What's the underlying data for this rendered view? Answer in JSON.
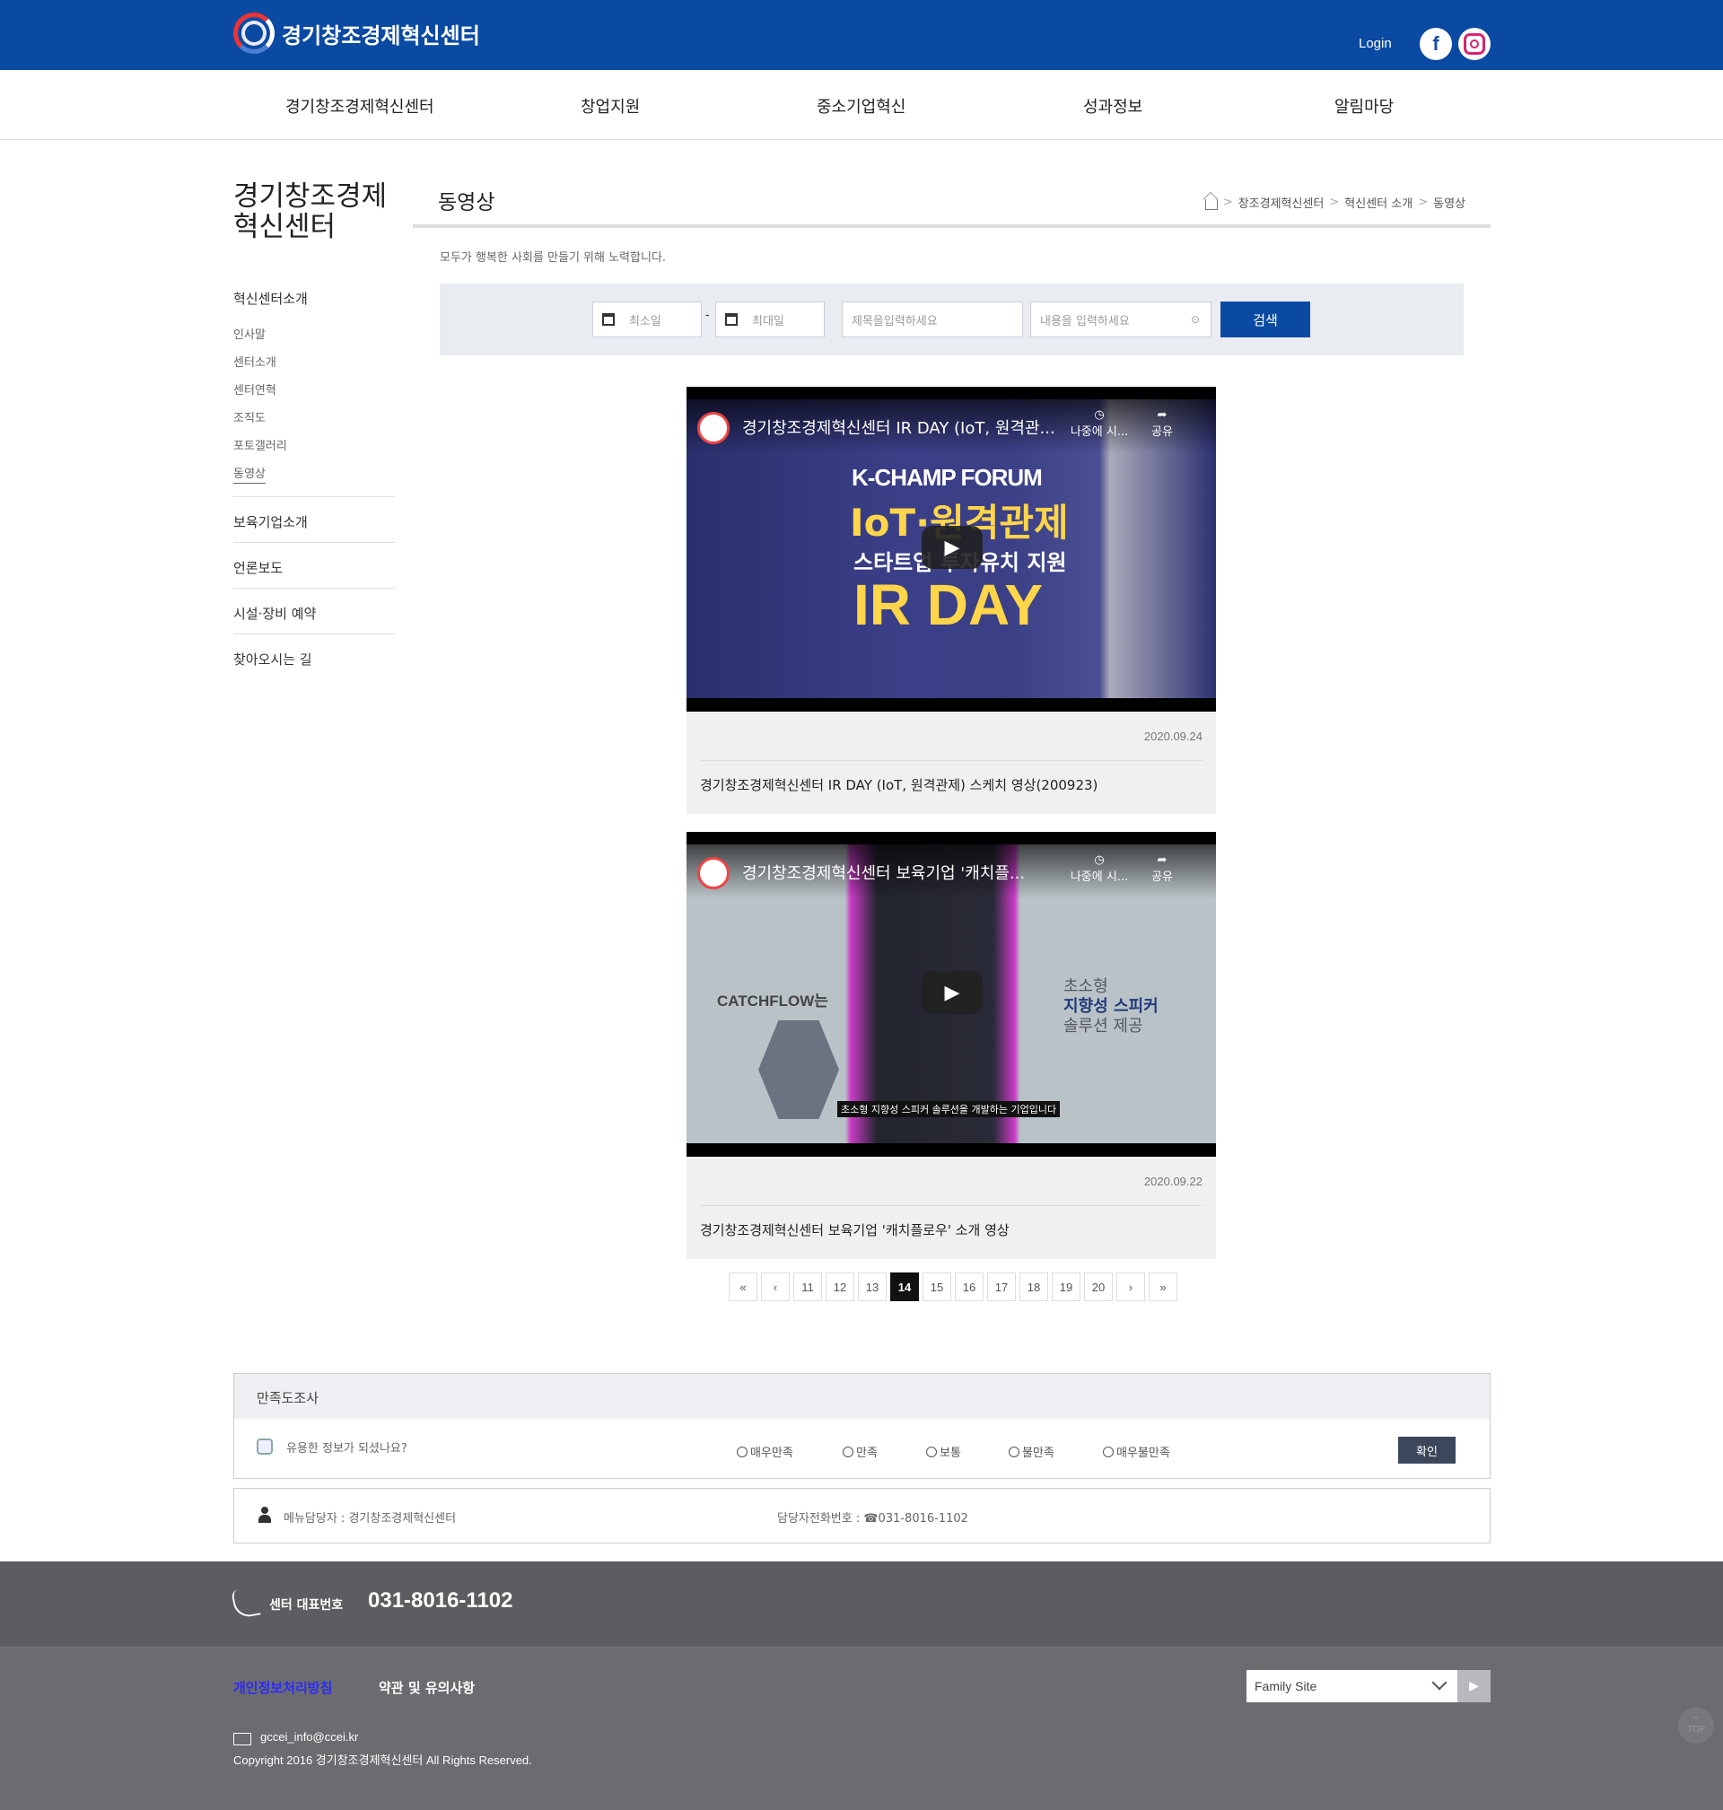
{
  "header": {
    "logo_text": "경기창조경제혁신센터",
    "login": "Login",
    "sns": [
      {
        "icon": "facebook-icon",
        "label": "f"
      },
      {
        "icon": "instagram-icon",
        "label": ""
      }
    ]
  },
  "gnb": [
    "경기창조경제혁신센터",
    "창업지원",
    "중소기업혁신",
    "성과정보",
    "알림마당"
  ],
  "lnb": {
    "title": "경기창조경제 혁신센터",
    "section": "혁신센터소개",
    "sub_items": [
      "인사말",
      "센터소개",
      "센터연혁",
      "조직도",
      "포토갤러리",
      "동영상"
    ],
    "active_sub": "동영상",
    "items": [
      "보육기업소개",
      "언론보도",
      "시설·장비 예약",
      "찾아오시는 길"
    ]
  },
  "content": {
    "title": "동영상",
    "breadcrumb": [
      "창조경제혁신센터",
      "혁신센터 소개",
      "동영상"
    ],
    "description": "모두가 행복한 사회를 만들기 위해 노력합니다."
  },
  "search": {
    "start_placeholder": "최소일",
    "end_placeholder": "최대일",
    "title_placeholder": "제목을입력하세요",
    "content_placeholder": "내용을 입력하세요",
    "button": "검색"
  },
  "videos": [
    {
      "player_title": "경기창조경제혁신센터 IR DAY (IoT, 원격관...",
      "later": "나중에 시...",
      "share": "공유",
      "overlay": {
        "line1": "K-CHAMP FORUM",
        "line2": "IoT·원격관제",
        "line3": "스타트업 투자유치 지원",
        "line4": "IR DAY"
      },
      "date": "2020.09.24",
      "title": "경기창조경제혁신센터 IR DAY (IoT, 원격관제) 스케치 영상(200923)"
    },
    {
      "player_title": "경기창조경제혁신센터 보육기업 '캐치플...",
      "later": "나중에 시...",
      "share": "공유",
      "overlay": {
        "brand": "CATCHFLOW는",
        "line1": "초소형",
        "line2": "지향성 스피커",
        "line3": "솔루션 제공",
        "subtitle": "초소형 지향성 스피커 솔루션을 개발하는 기업입니다"
      },
      "date": "2020.09.22",
      "title": "경기창조경제혁신센터 보육기업 '캐치플로우' 소개 영상"
    }
  ],
  "pagination": {
    "first": "«",
    "prev": "‹",
    "pages": [
      "11",
      "12",
      "13",
      "14",
      "15",
      "16",
      "17",
      "18",
      "19",
      "20"
    ],
    "current": "14",
    "next": "›",
    "last": "»"
  },
  "survey": {
    "title": "만족도조사",
    "question": "유용한 정보가 되셨나요?",
    "options": [
      "매우만족",
      "만족",
      "보통",
      "불만족",
      "매우불만족"
    ],
    "submit": "확인"
  },
  "manager": {
    "menu_manager": "메뉴담당자 : 경기창조경제혁신센터",
    "phone": "담당자전화번호 : ☎031-8016-1102"
  },
  "footer": {
    "tel_label": "센터 대표번호",
    "tel": "031-8016-1102",
    "links": [
      "개인정보처리방침",
      "약관 및 유의사항"
    ],
    "family_site": "Family Site",
    "go": "▶",
    "email": "gccei_info@ccei.kr",
    "copyright": "Copyright 2016 경기창조경제혁신센터 All Rights Reserved.",
    "top": "TOP"
  }
}
